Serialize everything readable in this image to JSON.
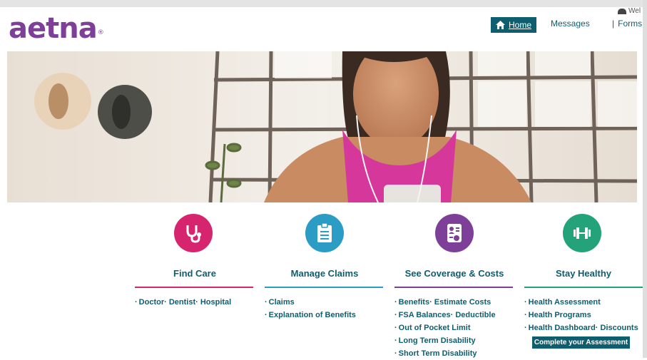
{
  "brand": {
    "logo_text": "aetna",
    "registered_mark": "®",
    "logo_color": "#7d3f98",
    "accent": "#0e5e6f"
  },
  "header": {
    "welcome_text": "Wel",
    "nav": {
      "home_label": "Home",
      "messages_label": "Messages",
      "forms_label": "Forms"
    }
  },
  "hero": {
    "image_description_icon": "woman-with-phone-photo"
  },
  "sections": [
    {
      "title": "Find Care",
      "icon": "stethoscope-icon",
      "color": "#d6246e",
      "links": [
        "Doctor· Dentist· Hospital"
      ]
    },
    {
      "title": "Manage Claims",
      "icon": "clipboard-icon",
      "color": "#2b9cc4",
      "links": [
        "Claims",
        "Explanation of Benefits"
      ]
    },
    {
      "title": "See Coverage & Costs",
      "icon": "id-card-icon",
      "color": "#7d3f98",
      "links": [
        "Benefits· Estimate Costs",
        "FSA Balances· Deductible",
        "Out of Pocket Limit",
        "Long Term Disability",
        "Short Term Disability"
      ]
    },
    {
      "title": "Stay Healthy",
      "icon": "dumbbell-icon",
      "color": "#24a37b",
      "links": [
        "Health Assessment",
        "Health Programs",
        "Health Dashboard· Discounts"
      ]
    }
  ],
  "assessment_button": "Complete your Assessment"
}
